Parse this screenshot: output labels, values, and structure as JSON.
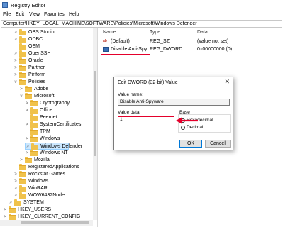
{
  "window": {
    "title": "Registry Editor"
  },
  "menu": [
    "File",
    "Edit",
    "View",
    "Favorites",
    "Help"
  ],
  "address": "Computer\\HKEY_LOCAL_MACHINE\\SOFTWARE\\Policies\\Microsoft\\Windows Defender",
  "tree": [
    {
      "label": "OBS Studio",
      "chevron": ">"
    },
    {
      "label": "ODBC",
      "chevron": ">"
    },
    {
      "label": "OEM",
      "chevron": ""
    },
    {
      "label": "OpenSSH",
      "chevron": ">"
    },
    {
      "label": "Oracle",
      "chevron": ">"
    },
    {
      "label": "Partner",
      "chevron": ">"
    },
    {
      "label": "Piriform",
      "chevron": ">"
    },
    {
      "label": "Policies",
      "chevron": "v"
    },
    {
      "label": "Adobe",
      "chevron": ">"
    },
    {
      "label": "Microsoft",
      "chevron": "v"
    },
    {
      "label": "Cryptography",
      "chevron": ">"
    },
    {
      "label": "Office",
      "chevron": ">"
    },
    {
      "label": "Peernet",
      "chevron": ""
    },
    {
      "label": "SystemCertificates",
      "chevron": ">"
    },
    {
      "label": "TPM",
      "chevron": ""
    },
    {
      "label": "Windows",
      "chevron": ">"
    },
    {
      "label": "Windows Defender",
      "chevron": ">",
      "selected": true
    },
    {
      "label": "Windows NT",
      "chevron": ">"
    },
    {
      "label": "Mozilla",
      "chevron": ">"
    },
    {
      "label": "RegisteredApplications",
      "chevron": ""
    },
    {
      "label": "Rockstar Games",
      "chevron": ">"
    },
    {
      "label": "Windows",
      "chevron": ">"
    },
    {
      "label": "WinRAR",
      "chevron": ">"
    },
    {
      "label": "WOW6432Node",
      "chevron": ">"
    },
    {
      "label": "SYSTEM",
      "chevron": ">"
    },
    {
      "label": "HKEY_USERS",
      "chevron": ">"
    },
    {
      "label": "HKEY_CURRENT_CONFIG",
      "chevron": ">"
    }
  ],
  "values": {
    "headers": {
      "name": "Name",
      "type": "Type",
      "data": "Data"
    },
    "rows": [
      {
        "icon": "string-value-icon",
        "name": "(Default)",
        "type": "REG_SZ",
        "data": "(value not set)"
      },
      {
        "icon": "binary-value-icon",
        "name": "Disable Anti-Spy...",
        "type": "REG_DWORD",
        "data": "0x00000000 (0)"
      }
    ]
  },
  "dialog": {
    "title": "Edit DWORD (32-bit) Value",
    "close": "✕",
    "value_name_label": "Value name:",
    "value_name": "Disable Anti-Spyware",
    "value_data_label": "Value data:",
    "value_data": "1",
    "base_label": "Base",
    "hex_label": "Hexadecimal",
    "dec_label": "Decimal",
    "ok_label": "OK",
    "cancel_label": "Cancel"
  },
  "colors": {
    "highlight": "#e4002b",
    "selection": "#cce8ff"
  }
}
